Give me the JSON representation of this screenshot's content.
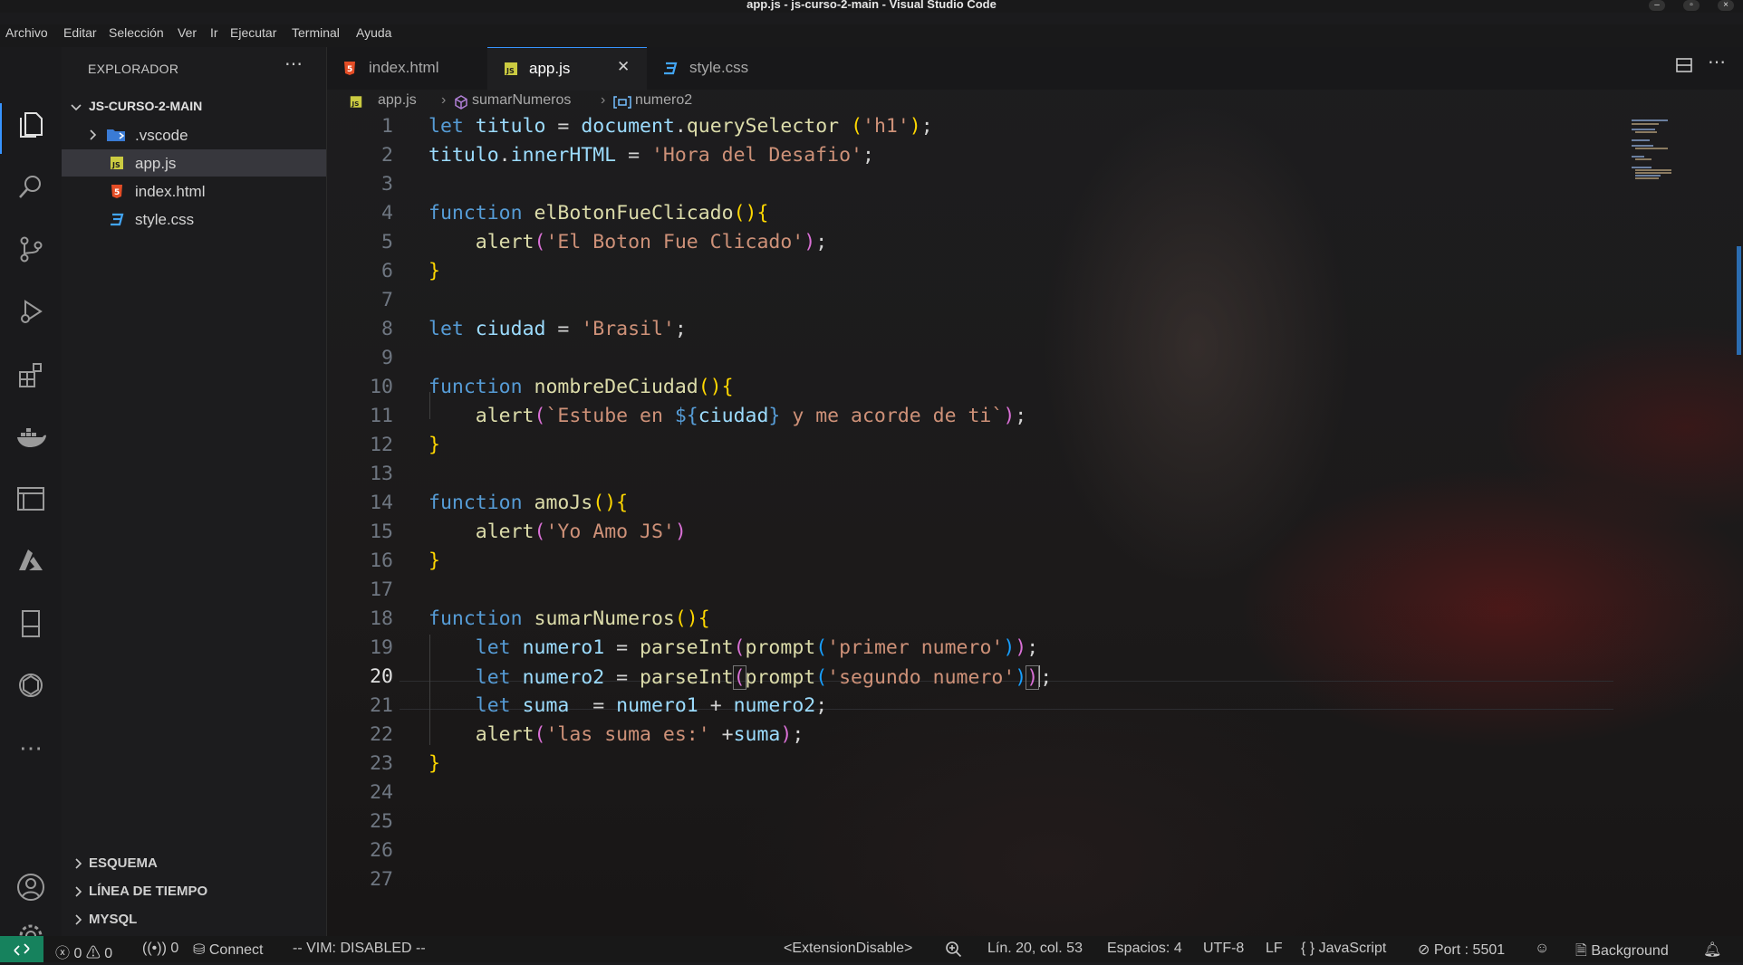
{
  "window": {
    "title": "app.js - js-curso-2-main - Visual Studio Code"
  },
  "menu": [
    "Archivo",
    "Editar",
    "Selección",
    "Ver",
    "Ir",
    "Ejecutar",
    "Terminal",
    "Ayuda"
  ],
  "sidebar": {
    "title": "EXPLORADOR",
    "root": "JS-CURSO-2-MAIN",
    "items": [
      {
        "label": ".vscode",
        "icon": "folder-vscode-icon"
      },
      {
        "label": "app.js",
        "icon": "js-file-icon"
      },
      {
        "label": "index.html",
        "icon": "html-file-icon"
      },
      {
        "label": "style.css",
        "icon": "css-file-icon"
      }
    ],
    "sections": [
      "ESQUEMA",
      "LÍNEA DE TIEMPO",
      "MYSQL"
    ]
  },
  "tabs": [
    {
      "label": "index.html",
      "icon": "html-file-icon"
    },
    {
      "label": "app.js",
      "icon": "js-file-icon"
    },
    {
      "label": "style.css",
      "icon": "css-file-icon"
    }
  ],
  "breadcrumb": [
    "app.js",
    "sumarNumeros",
    "numero2"
  ],
  "code": {
    "current_line": 20,
    "line_numbers": [
      "1",
      "2",
      "3",
      "4",
      "5",
      "6",
      "7",
      "8",
      "9",
      "10",
      "11",
      "12",
      "13",
      "14",
      "15",
      "16",
      "17",
      "18",
      "19",
      "20",
      "21",
      "22",
      "23",
      "24",
      "25",
      "26",
      "27"
    ]
  },
  "statusbar": {
    "errors": "0",
    "warnings": "0",
    "ports": "0",
    "connect": "Connect",
    "vim": "-- VIM: DISABLED --",
    "extension": "<ExtensionDisable>",
    "position": "Lín. 20, col. 53",
    "spaces": "Espacios: 4",
    "encoding": "UTF-8",
    "eol": "LF",
    "language": "JavaScript",
    "port": "Port : 5501",
    "background": "Background"
  },
  "colors": {
    "accent": "#3794ff",
    "remote": "#16825d",
    "keyword": "#569cd6",
    "string": "#ce9178",
    "function": "#dcdcaa",
    "variable": "#9cdcfe"
  }
}
